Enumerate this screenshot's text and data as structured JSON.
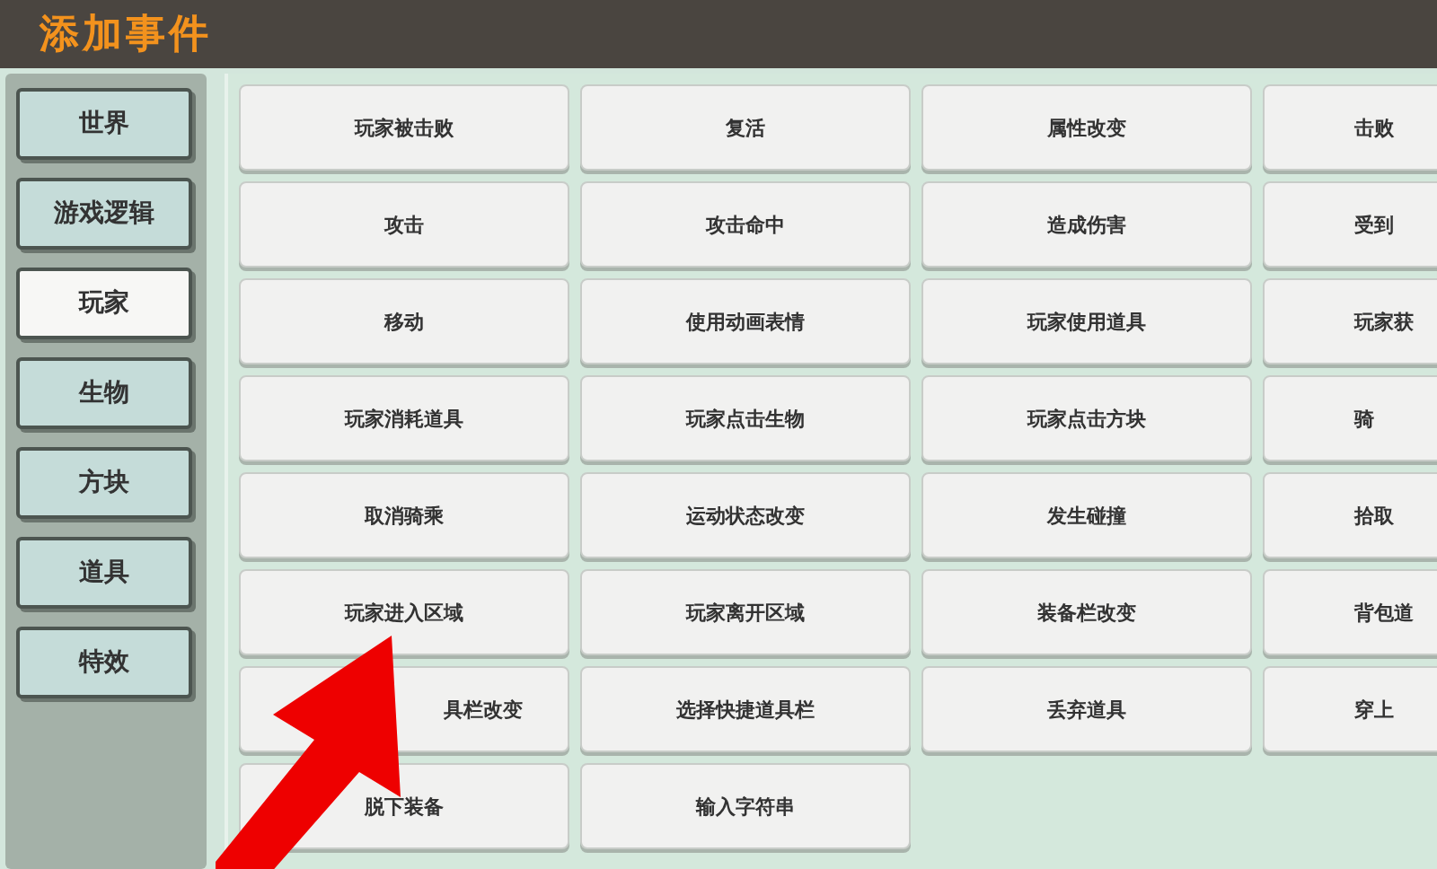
{
  "window": {
    "title": "添加事件"
  },
  "categories": [
    {
      "label": "世界",
      "selected": false
    },
    {
      "label": "游戏逻辑",
      "selected": false
    },
    {
      "label": "玩家",
      "selected": true
    },
    {
      "label": "生物",
      "selected": false
    },
    {
      "label": "方块",
      "selected": false
    },
    {
      "label": "道具",
      "selected": false
    },
    {
      "label": "特效",
      "selected": false
    }
  ],
  "events": [
    {
      "label": "玩家被击败"
    },
    {
      "label": "复活"
    },
    {
      "label": "属性改变"
    },
    {
      "label": "击败"
    },
    {
      "label": "攻击"
    },
    {
      "label": "攻击命中"
    },
    {
      "label": "造成伤害"
    },
    {
      "label": "受到"
    },
    {
      "label": "移动"
    },
    {
      "label": "使用动画表情"
    },
    {
      "label": "玩家使用道具"
    },
    {
      "label": "玩家获"
    },
    {
      "label": "玩家消耗道具"
    },
    {
      "label": "玩家点击生物"
    },
    {
      "label": "玩家点击方块"
    },
    {
      "label": "骑"
    },
    {
      "label": "取消骑乘"
    },
    {
      "label": "运动状态改变"
    },
    {
      "label": "发生碰撞"
    },
    {
      "label": "拾取"
    },
    {
      "label": "玩家进入区域"
    },
    {
      "label": "玩家离开区域"
    },
    {
      "label": "装备栏改变"
    },
    {
      "label": "背包道"
    },
    {
      "label": "具栏改变",
      "covered": true
    },
    {
      "label": "选择快捷道具栏"
    },
    {
      "label": "丢弃道具"
    },
    {
      "label": "穿上"
    },
    {
      "label": "脱下装备"
    },
    {
      "label": "输入字符串"
    }
  ]
}
